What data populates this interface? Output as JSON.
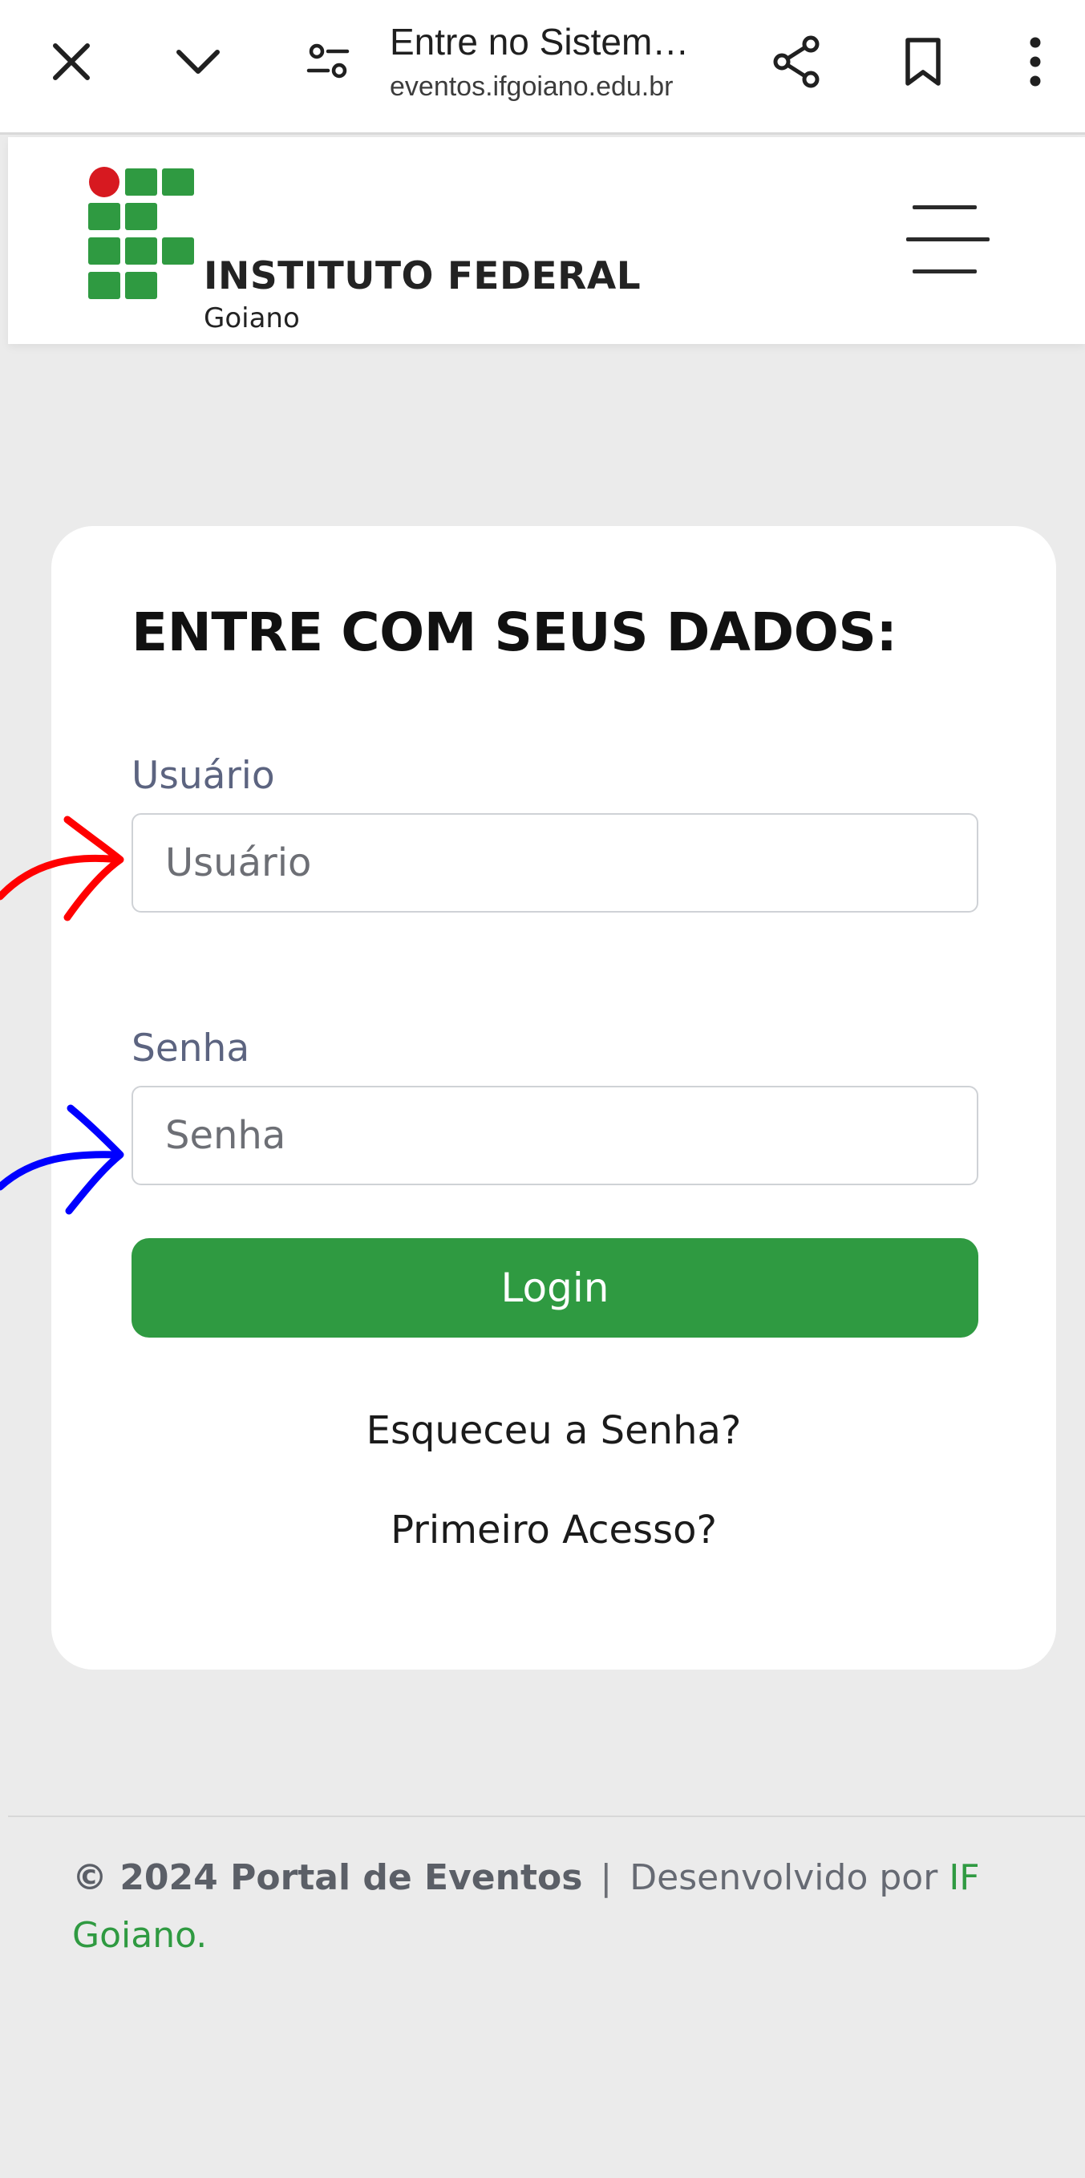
{
  "browser": {
    "title": "Entre no Sistem…",
    "url": "eventos.ifgoiano.edu.br",
    "icons": [
      "close-icon",
      "chevron-down-icon",
      "tune-icon",
      "share-icon",
      "bookmark-icon",
      "more-vert-icon"
    ]
  },
  "header": {
    "logo_main": "INSTITUTO FEDERAL",
    "logo_sub": "Goiano",
    "colors": {
      "logo_green": "#2f9a41",
      "logo_red": "#d71920"
    },
    "menu_icon": "hamburger-menu-icon"
  },
  "login": {
    "title": "ENTRE COM SEUS DADOS:",
    "user_label": "Usuário",
    "user_placeholder": "Usuário",
    "user_value": "",
    "password_label": "Senha",
    "password_placeholder": "Senha",
    "password_value": "",
    "login_button": "Login",
    "forgot_link": "Esqueceu a Senha?",
    "first_access_link": "Primeiro Acesso?",
    "colors": {
      "button": "#2f9a41"
    }
  },
  "annotations": {
    "user_arrow_color": "#ff0000",
    "password_arrow_color": "#0000ff"
  },
  "footer": {
    "copyright": "© 2024 Portal de Eventos",
    "separator": "|",
    "developed_by": "Desenvolvido por",
    "developer_link": "IF Goiano",
    "period": "."
  }
}
